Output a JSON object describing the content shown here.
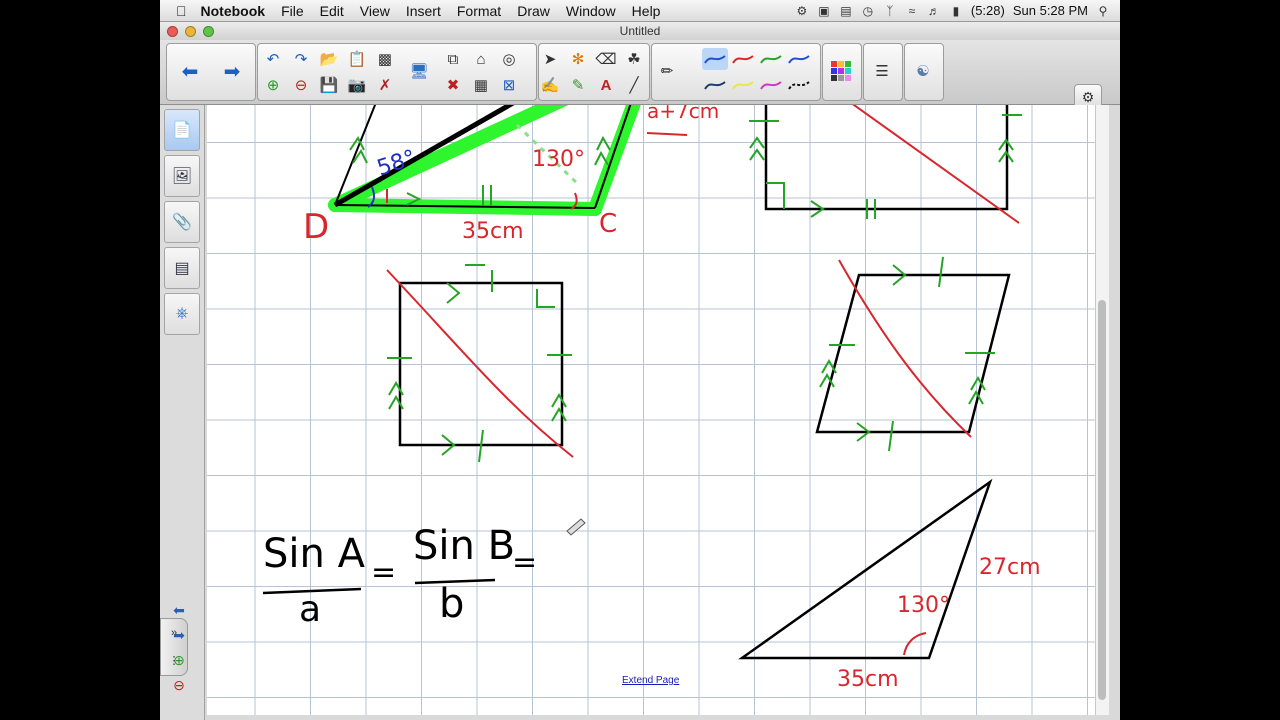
{
  "menubar": {
    "app_name": "Notebook",
    "items": [
      "File",
      "Edit",
      "View",
      "Insert",
      "Format",
      "Draw",
      "Window",
      "Help"
    ],
    "battery": "(5:28)",
    "clock": "Sun 5:28 PM"
  },
  "window": {
    "title": "Untitled"
  },
  "canvas": {
    "label_D": "D",
    "label_C": "C",
    "label_35cm_top": "35cm",
    "label_angle_58": "58°",
    "label_angle_130_top": "130°",
    "label_top_partial": "a+7cm",
    "formula_num_a": "Sin A",
    "formula_den_a": "a",
    "formula_num_b": "Sin B",
    "formula_den_b": "b",
    "formula_eq": "=",
    "label_27cm": "27cm",
    "label_130": "130°",
    "label_35cm_bottom": "35cm"
  },
  "extend_page": "Extend Page",
  "colors": {
    "pen_red": "#d8262c",
    "pen_green": "#24a524",
    "highlight_green": "#2ef52e",
    "ink_black": "#000000",
    "ink_blue": "#2030c0"
  }
}
